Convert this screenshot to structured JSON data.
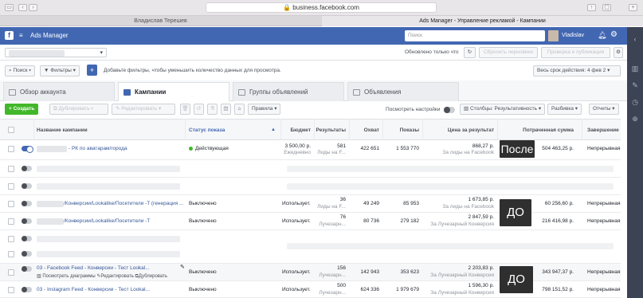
{
  "browser": {
    "url": "business.facebook.com",
    "tabs": [
      "Владислав Терешев",
      "Ads Manager - Управление рекламой - Кампании"
    ]
  },
  "fb_bar": {
    "app_title": "Ads Manager",
    "search_placeholder": "Поиск",
    "user_name": "Vladislav"
  },
  "toolbar": {
    "updated_text": "Обновлено только что",
    "discard_drafts": "Сбросить черновики",
    "review_publish": "Проверка и публикация"
  },
  "filter_bar": {
    "search": "Поиск",
    "filters": "Фильтры",
    "add_filter_hint": "Добавьте фильтры, чтобы уменьшить количество данных для просмотра.",
    "date_range": "Весь срок действия: 4 фев 2"
  },
  "main_tabs": [
    "Обзор аккаунта",
    "Кампании",
    "Группы объявлений",
    "Объявления"
  ],
  "actions": {
    "create": "Создать",
    "duplicate": "Дублировать",
    "edit": "Редактировать",
    "rules": "Правила",
    "view_settings": "Посмотреть настройки",
    "columns": "Столбцы: Результативность",
    "breakdown": "Разбивка",
    "reports": "Отчеты"
  },
  "table": {
    "headers": {
      "name": "Название кампании",
      "status": "Статус показа",
      "budget": "Бюджет",
      "results": "Результаты",
      "reach": "Охват",
      "impressions": "Показы",
      "cost": "Цена за результат",
      "spent": "Потраченная сумма",
      "end": "Завершение"
    },
    "rows": [
      {
        "toggle": "on",
        "name": "- РК по аватарам/города",
        "status": "Действующая",
        "status_active": true,
        "budget": "3 500,00 р.",
        "budget_sub": "Ежедневно",
        "results": "581",
        "results_sub": "Лиды на F...",
        "reach": "422 651",
        "impressions": "1 553 770",
        "cost": "868,27 р.",
        "cost_sub": "За лиды на Facebook",
        "spent": "504 463,25 р.",
        "end": "Непрерывная",
        "badge": "После"
      },
      {
        "toggle": "off",
        "blurred": true
      },
      {
        "toggle": "off",
        "blurred": true
      },
      {
        "toggle": "off",
        "name": "/Конверсии/Lookalike/Посетители -T (генерация ...",
        "status": "Выключено",
        "budget": "Использует...",
        "results": "36",
        "results_sub": "Лиды на F...",
        "reach": "49 249",
        "impressions": "85 953",
        "cost": "1 673,85 р.",
        "cost_sub": "За лиды на Facebook",
        "spent": "60 256,60 р.",
        "end": "Непрерывная",
        "badge": "ДО"
      },
      {
        "toggle": "off",
        "name": "/Конверсии/Lookalike/Посетители -T",
        "status": "Выключено",
        "budget": "Использует...",
        "results": "76",
        "results_sub": "Лучезарн...",
        "reach": "80 736",
        "impressions": "279 182",
        "cost": "2 847,59 р.",
        "cost_sub": "За Лучезарный Конверсия",
        "spent": "216 416,98 р.",
        "end": "Непрерывная"
      },
      {
        "toggle": "off",
        "blurred": true
      },
      {
        "toggle": "off",
        "name": "03 - Facebook Feed - Конверсии - Тест Lookal...",
        "status": "Выключено",
        "budget": "Использует...",
        "results": "156",
        "results_sub": "Лучезарн...",
        "reach": "142 943",
        "impressions": "353 623",
        "cost": "2 203,83 р.",
        "cost_sub": "За Лучезарный Конверсия",
        "spent": "343 947,37 р.",
        "end": "Непрерывная",
        "row_actions": [
          "Посмотреть диаграммы",
          "Редактировать",
          "Дублировать"
        ],
        "badge": "ДО"
      },
      {
        "toggle": "off",
        "name": "03 - Instagram Feed - Конверсии - Тест Lookal...",
        "status": "Выключено",
        "budget": "Использует...",
        "results": "500",
        "results_sub": "Лучезарн...",
        "reach": "624 336",
        "impressions": "1 979 679",
        "cost": "1 596,30 р.",
        "cost_sub": "За Лучезарный Конверсия",
        "spent": "798 151,52 р.",
        "end": "Непрерывная"
      }
    ]
  }
}
